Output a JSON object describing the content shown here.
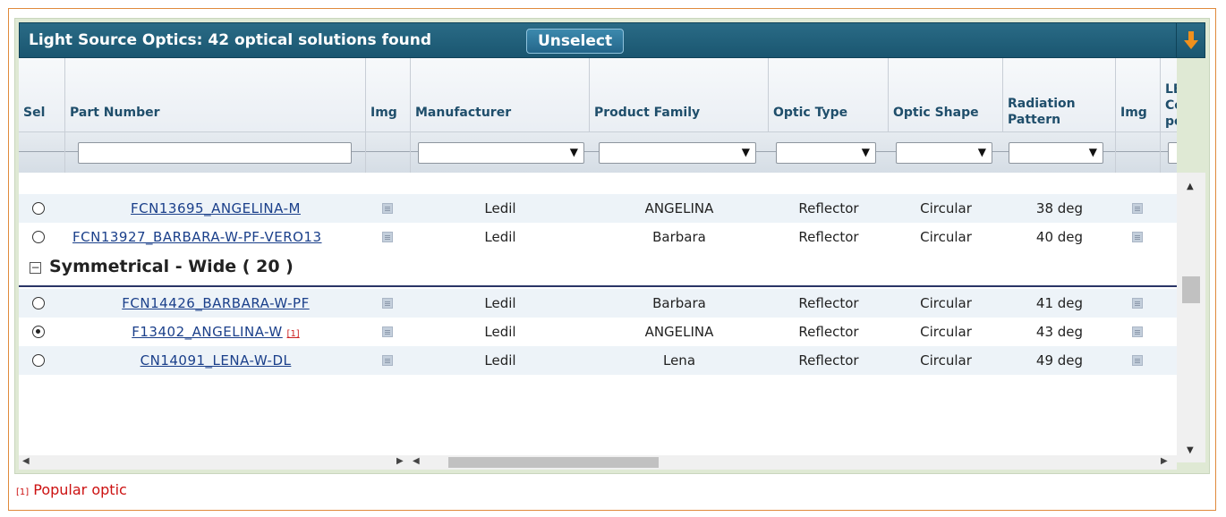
{
  "header": {
    "title": "Light Source Optics: 42 optical solutions found",
    "unselect_label": "Unselect"
  },
  "columns": [
    "Sel",
    "Part Number",
    "Img",
    "Manufacturer",
    "Product Family",
    "Optic Type",
    "Optic Shape",
    "Radiation Pattern",
    "Img",
    "LED Count per Optic"
  ],
  "filters": {
    "part_number_value": "",
    "manufacturer_value": "",
    "product_family_value": "",
    "optic_type_value": "",
    "optic_shape_value": "",
    "radiation_pattern_value": ""
  },
  "rows_top": [
    {
      "selected": false,
      "part": "FCN13695_ANGELINA-M",
      "marker": "",
      "manufacturer": "Ledil",
      "family": "ANGELINA",
      "type": "Reflector",
      "shape": "Circular",
      "pattern": "38 deg"
    },
    {
      "selected": false,
      "part": "FCN13927_BARBARA-W-PF-VERO13",
      "marker": "",
      "manufacturer": "Ledil",
      "family": "Barbara",
      "type": "Reflector",
      "shape": "Circular",
      "pattern": "40 deg"
    }
  ],
  "group": {
    "toggle": "−",
    "label": "Symmetrical - Wide ( 20 )"
  },
  "rows_group": [
    {
      "selected": false,
      "part": "FCN14426_BARBARA-W-PF",
      "marker": "",
      "manufacturer": "Ledil",
      "family": "Barbara",
      "type": "Reflector",
      "shape": "Circular",
      "pattern": "41 deg"
    },
    {
      "selected": true,
      "part": "F13402_ANGELINA-W",
      "marker": "[1]",
      "manufacturer": "Ledil",
      "family": "ANGELINA",
      "type": "Reflector",
      "shape": "Circular",
      "pattern": "43 deg"
    },
    {
      "selected": false,
      "part": "CN14091_LENA-W-DL",
      "marker": "",
      "manufacturer": "Ledil",
      "family": "Lena",
      "type": "Reflector",
      "shape": "Circular",
      "pattern": "49 deg"
    }
  ],
  "footnote": {
    "marker": "[1]",
    "text": "Popular optic"
  },
  "icons": {
    "export": "download-arrow-icon",
    "image": "image-thumbnail-icon",
    "group_toggle": "collapse-minus-icon"
  },
  "colors": {
    "title_bar": "#1f5f7a",
    "accent_orange": "#f0901c",
    "link": "#1a3f8a",
    "footnote": "#cc1111",
    "row_alt": "#edf3f8"
  }
}
